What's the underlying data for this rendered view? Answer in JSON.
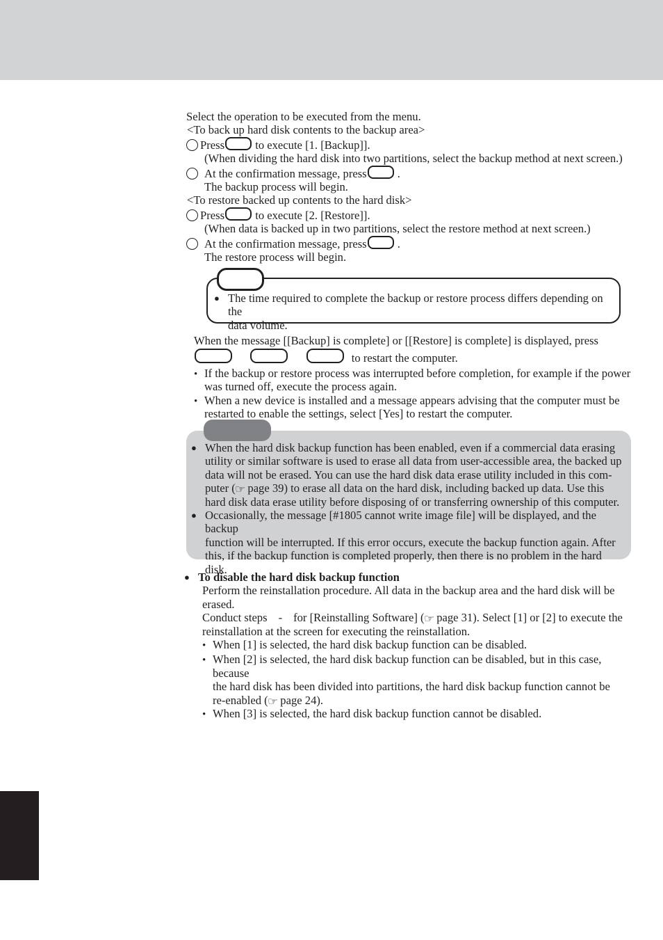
{
  "page": {
    "header_band_color": "#d2d3d5",
    "edge_tab_color": "#231f20",
    "caution_box_color": "#d0d1d3",
    "caution_tab_color": "#808285"
  },
  "intro": {
    "line1": "Select the operation to be executed from the menu.",
    "backup_heading": "<To back up hard disk contents to the backup area>",
    "restore_heading": "<To restore backed up contents to the hard disk>"
  },
  "backup_steps": {
    "step1_pre": "Press",
    "step1_post": "to execute [1. [Backup]].",
    "step1_note": "(When dividing the hard disk into two partitions, select the backup method at next screen.)",
    "step2_pre": "At the confirmation message, press",
    "step2_post": ".",
    "step2_note": "The backup process will begin."
  },
  "restore_steps": {
    "step1_pre": "Press",
    "step1_post": "to execute [2. [Restore]].",
    "step1_note": "(When data is backed up in two partitions, select the restore method at next screen.)",
    "step2_pre": "At the confirmation message, press",
    "step2_post": ".",
    "step2_note": "The restore process will begin."
  },
  "note_box": {
    "label": "",
    "text_line1": "The time required to complete the backup or restore process differs depending on the",
    "text_line2": "data volume."
  },
  "restart": {
    "line1": "When the message [[Backup] is complete] or [[Restore] is complete] is displayed, press",
    "line2_post": "to restart the computer.",
    "bullet1_line1": "If the backup or restore process was interrupted before completion, for example if the power",
    "bullet1_line2": "was turned off, execute the process again.",
    "bullet2_line1": "When a new device is installed and a message appears advising that the computer must be",
    "bullet2_line2": "restarted to enable the settings, select [Yes] to restart the computer."
  },
  "caution_box": {
    "label": "",
    "item1_line1": "When the hard disk backup function has been enabled, even if a commercial data erasing",
    "item1_line2": "utility or similar software is used to erase all data from user-accessible area, the backed up",
    "item1_line3": "data will not be erased.  You can use the hard disk data erase utility included in this com-",
    "item1_line4_pre": "puter (",
    "item1_line4_ref": "page 39",
    "item1_line4_post": ") to erase all data on the hard disk, including backed up data. Use this",
    "item1_line5": "hard disk data erase utility before disposing of or transferring ownership of this computer.",
    "item2_line1": "Occasionally, the message [#1805 cannot write image file] will be displayed, and the backup",
    "item2_line2": "function will be interrupted.  If this error occurs, execute the backup function again.  After",
    "item2_line3": "this, if the backup function is completed properly, then there is no problem in the hard disk."
  },
  "disable_section": {
    "heading": "To disable the hard disk backup function",
    "line1": "Perform the reinstallation procedure.  All data in the backup area and the hard disk will be",
    "line2": "erased.",
    "line3_pre": "Conduct steps",
    "line3_dash": "-",
    "line3_mid": "for [Reinstalling Software]  (",
    "line3_ref": "page 31",
    "line3_post": "). Select [1] or [2] to execute the",
    "line4": "reinstallation at the screen for executing the reinstallation.",
    "bullet1": "When [1] is selected, the hard disk backup function can be disabled.",
    "bullet2_line1": "When [2] is selected, the hard disk backup function can be disabled, but in this case, because",
    "bullet2_line2": "the hard disk has been divided into partitions, the hard disk backup function cannot be",
    "bullet2_line3_pre": "re-enabled  (",
    "bullet2_line3_ref": "page 24",
    "bullet2_line3_post": ").",
    "bullet3": "When [3] is selected, the hard disk backup function cannot be disabled."
  },
  "icons": {
    "pointing_hand": "☞"
  }
}
